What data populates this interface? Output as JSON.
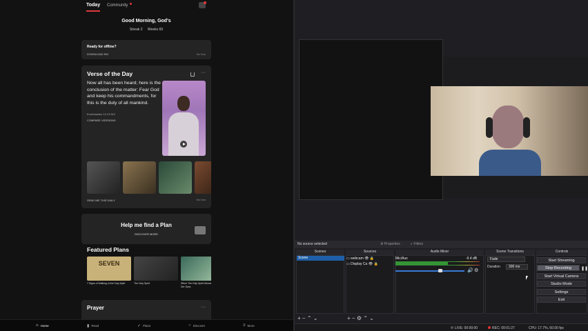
{
  "bible": {
    "tabs": {
      "today": "Today",
      "community": "Community"
    },
    "greeting": "Good Morning, God's",
    "stats": {
      "streak": "Streak 2",
      "weeks": "Weeks 69"
    },
    "offline": {
      "title": "Ready for offline?",
      "download": "DOWNLOAD NIV",
      "not_now": "Not Now"
    },
    "votd": {
      "title": "Verse of the Day",
      "text": "Now all has been heard; here is the conclusion of the matter: Fear God and keep his commandments, for this is the duty of all mankind.",
      "reference": "Ecclesiastes 12:13 NIV",
      "compare": "COMPARE VERSIONS",
      "send": "SEND ME THIS DAILY",
      "not_now": "Not Now"
    },
    "plan": {
      "title": "Help me find a Plan",
      "discover": "DISCOVER MORE"
    },
    "featured": {
      "title": "Featured Plans",
      "items": [
        {
          "label": "7 Signs of Walking in the Holy Spirit",
          "cover": "SEVEN"
        },
        {
          "label": "The Holy Spirit",
          "cover": ""
        },
        {
          "label": "When The Holy Spirit Moves: Dictée Van Der Dyss",
          "cover": ""
        }
      ]
    },
    "prayer": {
      "title": "Prayer"
    },
    "nav": {
      "home": "Home",
      "read": "Read",
      "plans": "Plans",
      "discover": "Discover",
      "more": "More"
    }
  },
  "obs": {
    "no_source": "No source selected",
    "properties": "Properties",
    "filters": "Filters",
    "docks": {
      "scenes": "Scenes",
      "sources": "Sources",
      "mixer": "Audio Mixer",
      "transitions": "Scene Transitions",
      "controls": "Controls"
    },
    "scene_item": "Scene",
    "sources_list": [
      "webcam",
      "Display Ca"
    ],
    "mixer": {
      "name": "Mic/Aux",
      "db": "-9.4 dB",
      "level": 0.62
    },
    "transition": {
      "type": "Fade",
      "duration_label": "Duration",
      "duration": "300 ms"
    },
    "controls": [
      "Start Streaming",
      "Stop Recording",
      "Start Virtual Camera",
      "Studio Mode",
      "Settings",
      "Exit"
    ],
    "status": {
      "live": "LIVE: 00:00:00",
      "rec": "REC: 00:01:27",
      "cpu": "CPU: 17.7%, 60.00 fps"
    },
    "colors": {
      "scene_selected": "#1e5fa8",
      "rec": "#dd3333"
    }
  }
}
